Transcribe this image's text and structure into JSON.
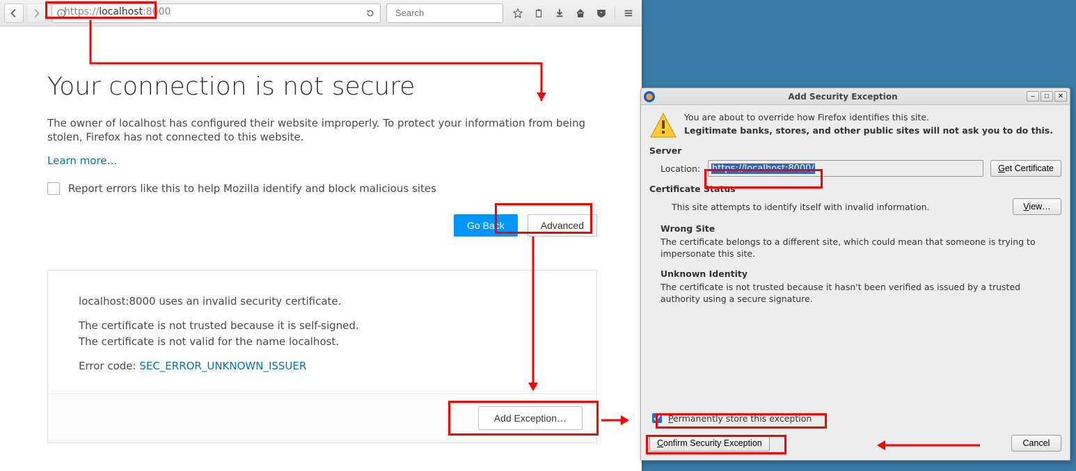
{
  "toolbar": {
    "url": "https://localhost:8000",
    "url_proto": "https://",
    "url_host": "localhost",
    "url_port": ":8000",
    "search_placeholder": "Search"
  },
  "page": {
    "heading": "Your connection is not secure",
    "paragraph": "The owner of localhost has configured their website improperly. To protect your information from being stolen, Firefox has not connected to this website.",
    "learn_more": "Learn more…",
    "report_label": "Report errors like this to help Mozilla identify and block malicious sites",
    "go_back": "Go Back",
    "advanced": "Advanced"
  },
  "advanced_panel": {
    "line1": "localhost:8000 uses an invalid security certificate.",
    "line2a": "The certificate is not trusted because it is self-signed.",
    "line2b": "The certificate is not valid for the name localhost.",
    "error_label": "Error code: ",
    "error_code": "SEC_ERROR_UNKNOWN_ISSUER",
    "add_exception": "Add Exception…"
  },
  "dialog": {
    "title": "Add Security Exception",
    "intro": "You are about to override how Firefox identifies this site.",
    "bold": "Legitimate banks, stores, and other public sites will not ask you to do this.",
    "server_h": "Server",
    "location_label": "Location:",
    "location_value": "https://localhost:8000/",
    "get_cert": "Get Certificate",
    "cert_status_h": "Certificate Status",
    "cert_status_txt": "This site attempts to identify itself with invalid information.",
    "view": "View…",
    "wrong_site_h": "Wrong Site",
    "wrong_site_txt": "The certificate belongs to a different site, which could mean that someone is trying to impersonate this site.",
    "unknown_h": "Unknown Identity",
    "unknown_txt": "The certificate is not trusted because it hasn't been verified as issued by a trusted authority using a secure signature.",
    "perm_label": "Permanently store this exception",
    "confirm": "Confirm Security Exception",
    "cancel": "Cancel"
  }
}
